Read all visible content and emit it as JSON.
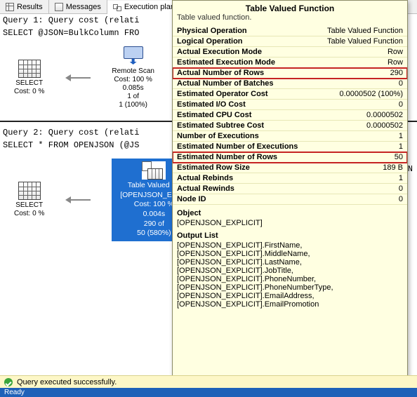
{
  "tabs": {
    "results": "Results",
    "messages": "Messages",
    "exec_plan": "Execution plan"
  },
  "query1": {
    "header": "Query 1: Query cost (relati",
    "sql": "SELECT @JSON=BulkColumn FRO",
    "select_label": "SELECT",
    "select_cost": "Cost: 0 %",
    "rscan_title": "Remote Scan",
    "rscan_cost": "Cost: 100 %",
    "rscan_time": "0.085s",
    "rscan_rows1": "1 of",
    "rscan_rows2": "1 (100%)"
  },
  "query2": {
    "header": "Query 2: Query cost (relati",
    "sql": "SELECT * FROM OPENJSON (@JS",
    "select_label": "SELECT",
    "select_cost": "Cost: 0 %",
    "tvf_line1": "Table Valued Fu",
    "tvf_line2": "[OPENJSON_EXPLI",
    "tvf_cost": "Cost: 100 %",
    "tvf_time": "0.004s",
    "tvf_rows1": "290 of",
    "tvf_rows2": "50 (580%)"
  },
  "tooltip": {
    "title": "Table Valued Function",
    "subtitle": "Table valued function.",
    "rows": [
      {
        "k": "Physical Operation",
        "v": "Table Valued Function",
        "hl": false
      },
      {
        "k": "Logical Operation",
        "v": "Table Valued Function",
        "hl": false
      },
      {
        "k": "Actual Execution Mode",
        "v": "Row",
        "hl": false
      },
      {
        "k": "Estimated Execution Mode",
        "v": "Row",
        "hl": false
      },
      {
        "k": "Actual Number of Rows",
        "v": "290",
        "hl": true
      },
      {
        "k": "Actual Number of Batches",
        "v": "0",
        "hl": false
      },
      {
        "k": "Estimated Operator Cost",
        "v": "0.0000502 (100%)",
        "hl": false
      },
      {
        "k": "Estimated I/O Cost",
        "v": "0",
        "hl": false
      },
      {
        "k": "Estimated CPU Cost",
        "v": "0.0000502",
        "hl": false
      },
      {
        "k": "Estimated Subtree Cost",
        "v": "0.0000502",
        "hl": false
      },
      {
        "k": "Number of Executions",
        "v": "1",
        "hl": false
      },
      {
        "k": "Estimated Number of Executions",
        "v": "1",
        "hl": false
      },
      {
        "k": "Estimated Number of Rows",
        "v": "50",
        "hl": true
      },
      {
        "k": "Estimated Row Size",
        "v": "189 B",
        "hl": false
      },
      {
        "k": "Actual Rebinds",
        "v": "1",
        "hl": false
      },
      {
        "k": "Actual Rewinds",
        "v": "0",
        "hl": false
      },
      {
        "k": "Node ID",
        "v": "0",
        "hl": false
      }
    ],
    "object_label": "Object",
    "object_value": "[OPENJSON_EXPLICIT]",
    "output_label": "Output List",
    "output_lines": [
      "[OPENJSON_EXPLICIT].FirstName,",
      "[OPENJSON_EXPLICIT].MiddleName,",
      "[OPENJSON_EXPLICIT].LastName,",
      "[OPENJSON_EXPLICIT].JobTitle,",
      "[OPENJSON_EXPLICIT].PhoneNumber,",
      "[OPENJSON_EXPLICIT].PhoneNumberType,",
      "[OPENJSON_EXPLICIT].EmailAddress,",
      "[OPENJSON_EXPLICIT].EmailPromotion"
    ]
  },
  "status": {
    "text": "Query executed successfully."
  },
  "ready": "Ready",
  "stray": "eN"
}
